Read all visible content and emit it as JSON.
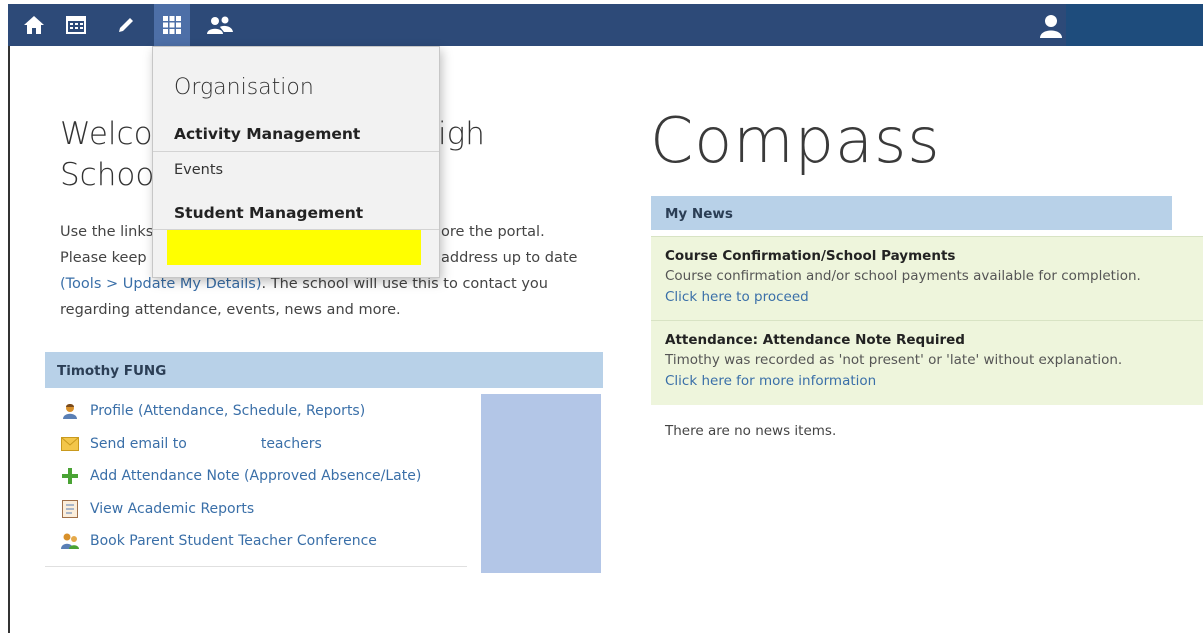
{
  "nav": {
    "icons": [
      "home-icon",
      "calendar-icon",
      "pencil-icon",
      "grid-icon",
      "people-icon"
    ],
    "user_icon": "user-icon",
    "colors": {
      "bar": "#2d4a78",
      "active": "#4d6fa7",
      "user_panel": "#1e4c7c"
    }
  },
  "dropdown": {
    "title": "Organisation",
    "sections": [
      {
        "label": "Activity Management",
        "items": [
          "Events"
        ]
      },
      {
        "label": "Student Management",
        "items": [
          ""
        ]
      }
    ],
    "highlight_color": "#ffff00"
  },
  "welcome": {
    "title_line1": "Welco",
    "title_line1_tail": "igh",
    "title_line2": "Schoo",
    "intro_line1": "Use the links",
    "intro_line1_tail": "ore the portal.",
    "intro_line2": "Please keep",
    "intro_line2_tail": "address up to date",
    "intro_link": "(Tools > Update My Details)",
    "intro_line3_tail": ". The school will use this to contact you",
    "intro_line4": "regarding attendance, events, news and more."
  },
  "student": {
    "name": "Timothy FUNG",
    "links": [
      {
        "label": "Profile (Attendance, Schedule, Reports)",
        "icon": "profile-icon"
      },
      {
        "label": "Send email to",
        "label_tail": "teachers",
        "icon": "envelope-icon"
      },
      {
        "label": "Add Attendance Note (Approved Absence/Late)",
        "icon": "plus-icon"
      },
      {
        "label": "View Academic Reports",
        "icon": "report-icon"
      },
      {
        "label": "Book Parent Student Teacher Conference",
        "icon": "conference-icon"
      }
    ]
  },
  "compass": {
    "title": "Compass",
    "news_header": "My News",
    "news": [
      {
        "title": "Course Confirmation/School Payments",
        "desc": "Course confirmation and/or school payments available for completion.",
        "link": "Click here to proceed"
      },
      {
        "title": "Attendance: Attendance Note Required",
        "desc": "Timothy was recorded as 'not present' or 'late' without explanation.",
        "link": "Click here for more information"
      }
    ],
    "no_news": "There are no news items."
  }
}
